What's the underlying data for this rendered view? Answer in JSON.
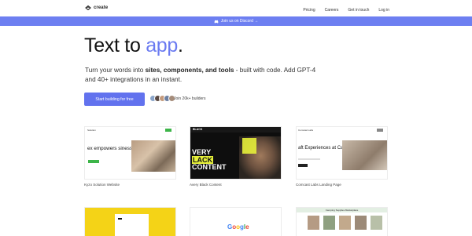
{
  "nav": {
    "brand": "create",
    "links": [
      "Pricing",
      "Careers",
      "Get in touch",
      "Log in"
    ]
  },
  "banner": {
    "text": "Join us on Discord →"
  },
  "hero": {
    "title_main": "Text to ",
    "title_accent": "app",
    "title_end": ".",
    "subtitle_pre": "Turn your words into ",
    "subtitle_bold": "sites, components, and tools",
    "subtitle_post": " - built with code. Add GPT-4 and 40+ integrations in an instant.",
    "cta_label": "Start building for free",
    "join_text": "Join 20k+ builders"
  },
  "cards": [
    {
      "label": "Kyzo Solution Website",
      "headline": "ex empowers sinesses",
      "nav": "Solution"
    },
    {
      "label": "Avery Black Content",
      "headline_1": "VERY",
      "headline_2": "LACK",
      "headline_3": "CONTENT",
      "tag": "BLACK"
    },
    {
      "label": "Comcast Labs Landing Page",
      "headline": "aft Experiences at Captivate",
      "nav": "Comcast Labs"
    }
  ],
  "bottom": {
    "google": "Google",
    "bar_text": "Camping Supplies Marketplace"
  },
  "colors": {
    "accent": "#6b7bf1",
    "banner": "#6d7ff1",
    "cta": "#6272ee"
  }
}
